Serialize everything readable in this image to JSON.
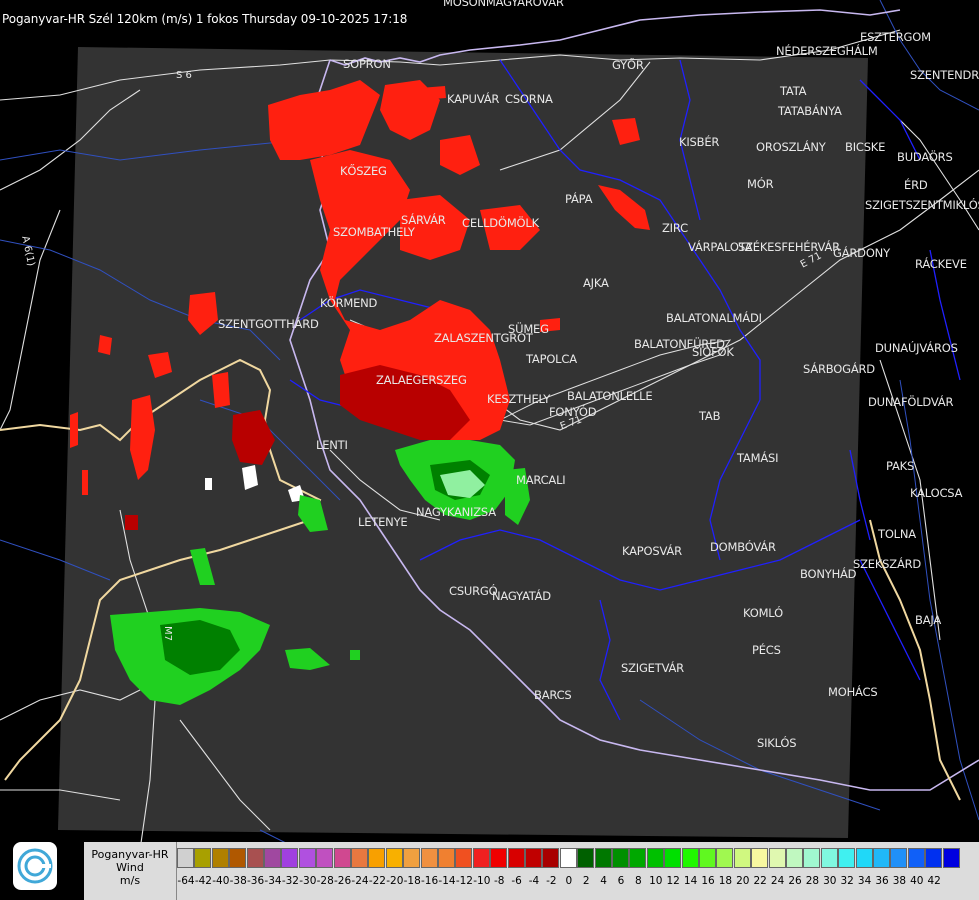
{
  "header": {
    "title": "Poganyvar-HR Szél 120km (m/s) 1 fokos Thursday 09-10-2025 17:18"
  },
  "map": {
    "roads": [
      "S 6",
      "A 6(1)",
      "E 71",
      "E 71",
      "M7"
    ],
    "cities": [
      {
        "name": "MOSONMAGYARÓVÁR"
      },
      {
        "name": "SOPRON"
      },
      {
        "name": "KAPUVÁR"
      },
      {
        "name": "CSORNA"
      },
      {
        "name": "GYŐR"
      },
      {
        "name": "NÉDERSZEGHÁLM"
      },
      {
        "name": "ESZTERGOM"
      },
      {
        "name": "SZENTENDRE"
      },
      {
        "name": "TATA"
      },
      {
        "name": "TATABÁNYA"
      },
      {
        "name": "KISBÉR"
      },
      {
        "name": "OROSZLÁNY"
      },
      {
        "name": "BICSKE"
      },
      {
        "name": "BUDAÖRS"
      },
      {
        "name": "ÉRD"
      },
      {
        "name": "SZIGETSZENTMIKLÓS"
      },
      {
        "name": "MÓR"
      },
      {
        "name": "KŐSZEG"
      },
      {
        "name": "PÁPA"
      },
      {
        "name": "SÁRVÁR"
      },
      {
        "name": "CELLDÖMÖLK"
      },
      {
        "name": "SZOMBATHELY"
      },
      {
        "name": "ZIRC"
      },
      {
        "name": "VÁRPALOTA"
      },
      {
        "name": "SZÉKESFEHÉRVÁR"
      },
      {
        "name": "GÁRDONY"
      },
      {
        "name": "RÁCKEVE"
      },
      {
        "name": "AJKA"
      },
      {
        "name": "KÖRMEND"
      },
      {
        "name": "SZENTGOTTHÁRD"
      },
      {
        "name": "BALATONALMÁDI"
      },
      {
        "name": "SÜMEG"
      },
      {
        "name": "ZALASZENTGRÓT"
      },
      {
        "name": "BALATONFÜRED"
      },
      {
        "name": "SIÓFOK"
      },
      {
        "name": "TAPOLCA"
      },
      {
        "name": "DUNAÚJVÁROS"
      },
      {
        "name": "SÁRBOGÁRD"
      },
      {
        "name": "ZALAEGERSZEG"
      },
      {
        "name": "KESZTHELY"
      },
      {
        "name": "BALATONLELLE"
      },
      {
        "name": "FONYÓD"
      },
      {
        "name": "DUNAFÖLDVÁR"
      },
      {
        "name": "TAB"
      },
      {
        "name": "LENTI"
      },
      {
        "name": "TAMÁSI"
      },
      {
        "name": "PAKS"
      },
      {
        "name": "MARCALI"
      },
      {
        "name": "KALOCSA"
      },
      {
        "name": "LETENYE"
      },
      {
        "name": "NAGYKANIZSA"
      },
      {
        "name": "TOLNA"
      },
      {
        "name": "KAPOSVÁR"
      },
      {
        "name": "DOMBÓVÁR"
      },
      {
        "name": "SZEKSZÁRD"
      },
      {
        "name": "BONYHÁD"
      },
      {
        "name": "CSURGÓ"
      },
      {
        "name": "NAGYATÁD"
      },
      {
        "name": "KOMLÓ"
      },
      {
        "name": "BAJA"
      },
      {
        "name": "PÉCS"
      },
      {
        "name": "SZIGETVÁR"
      },
      {
        "name": "MOHÁCS"
      },
      {
        "name": "BARCS"
      },
      {
        "name": "SIKLÓS"
      }
    ]
  },
  "legend": {
    "label_line1": "Poganyvar-HR",
    "label_line2": "Wind",
    "label_line3": "m/s",
    "colors": [
      "#d0d0d0",
      "#a8a000",
      "#b08000",
      "#b05800",
      "#a85050",
      "#a048a0",
      "#a040e0",
      "#b050e0",
      "#c050c0",
      "#d04890",
      "#e87840",
      "#f8a000",
      "#f8b000",
      "#f0a040",
      "#f09040",
      "#f08030",
      "#f05020",
      "#f02020",
      "#f00000",
      "#d80000",
      "#c00000",
      "#a80000",
      "#ffffff",
      "#006000",
      "#007800",
      "#009000",
      "#00a800",
      "#00c000",
      "#00e000",
      "#20f800",
      "#60f820",
      "#a0f850",
      "#d0f880",
      "#f8f8a0",
      "#e0f8b0",
      "#c0f8c0",
      "#a0f8d0",
      "#80f8e0",
      "#40f0f0",
      "#20d8f8",
      "#20b8f8",
      "#2090f8",
      "#1060f8",
      "#0030f0",
      "#0000e0"
    ],
    "ticks": [
      "-64",
      "-42",
      "-40",
      "-38",
      "-36",
      "-34",
      "-32",
      "-30",
      "-28",
      "-26",
      "-24",
      "-22",
      "-20",
      "-18",
      "-16",
      "-14",
      "-12",
      "-10",
      "-8",
      "-6",
      "-4",
      "-2",
      "0",
      "2",
      "4",
      "6",
      "8",
      "10",
      "12",
      "14",
      "16",
      "18",
      "20",
      "22",
      "24",
      "26",
      "28",
      "30",
      "32",
      "34",
      "36",
      "38",
      "40",
      "42"
    ]
  }
}
